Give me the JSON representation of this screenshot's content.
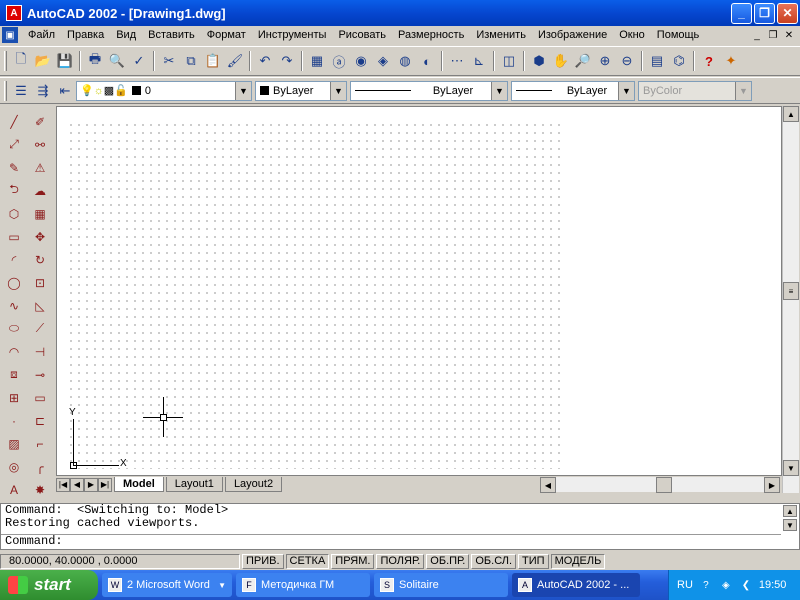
{
  "window": {
    "title": "AutoCAD 2002 - [Drawing1.dwg]",
    "app_icon": "A"
  },
  "menubar": {
    "items": [
      "Файл",
      "Правка",
      "Вид",
      "Вставить",
      "Формат",
      "Инструменты",
      "Рисовать",
      "Размерность",
      "Изменить",
      "Изображение",
      "Окно",
      "Помощь"
    ]
  },
  "toolbar1": {
    "icons": [
      "new",
      "open",
      "save",
      "print",
      "preview",
      "spell",
      "cut",
      "copy",
      "paste",
      "match",
      "undo",
      "redo",
      "properties",
      "icons",
      "icons",
      "icons",
      "icons",
      "dist",
      "ucs",
      "pan",
      "aerial",
      "zoom-realtime",
      "zoom-window",
      "zoom-previous",
      "properties",
      "design-center",
      "help",
      "today"
    ]
  },
  "layers": {
    "current_layer": "0",
    "color": "ByLayer",
    "linetype": "ByLayer",
    "lineweight": "ByLayer",
    "plotstyle": "ByColor"
  },
  "layout_tabs": [
    "Model",
    "Layout1",
    "Layout2"
  ],
  "command_window": {
    "lines": [
      "Command:  <Switching to: Model>",
      "Restoring cached viewports."
    ],
    "prompt": "Command:"
  },
  "status": {
    "coords": "80.0000, 40.0000 , 0.0000",
    "toggles": [
      "ПРИВ.",
      "СЕТКА",
      "ПРЯМ.",
      "ПОЛЯР.",
      "ОБ.ПР.",
      "ОБ.СЛ.",
      "ТИП",
      "МОДЕЛЬ"
    ]
  },
  "ucs": {
    "x": "X",
    "y": "Y"
  },
  "taskbar": {
    "start": "start",
    "tasks": [
      {
        "label": "2 Microsoft Word",
        "icon": "W"
      },
      {
        "label": "Методичка ГМ",
        "icon": "F"
      },
      {
        "label": "Solitaire",
        "icon": "S"
      },
      {
        "label": "AutoCAD 2002 - ...",
        "icon": "A"
      }
    ],
    "lang": "RU",
    "time": "19:50"
  }
}
